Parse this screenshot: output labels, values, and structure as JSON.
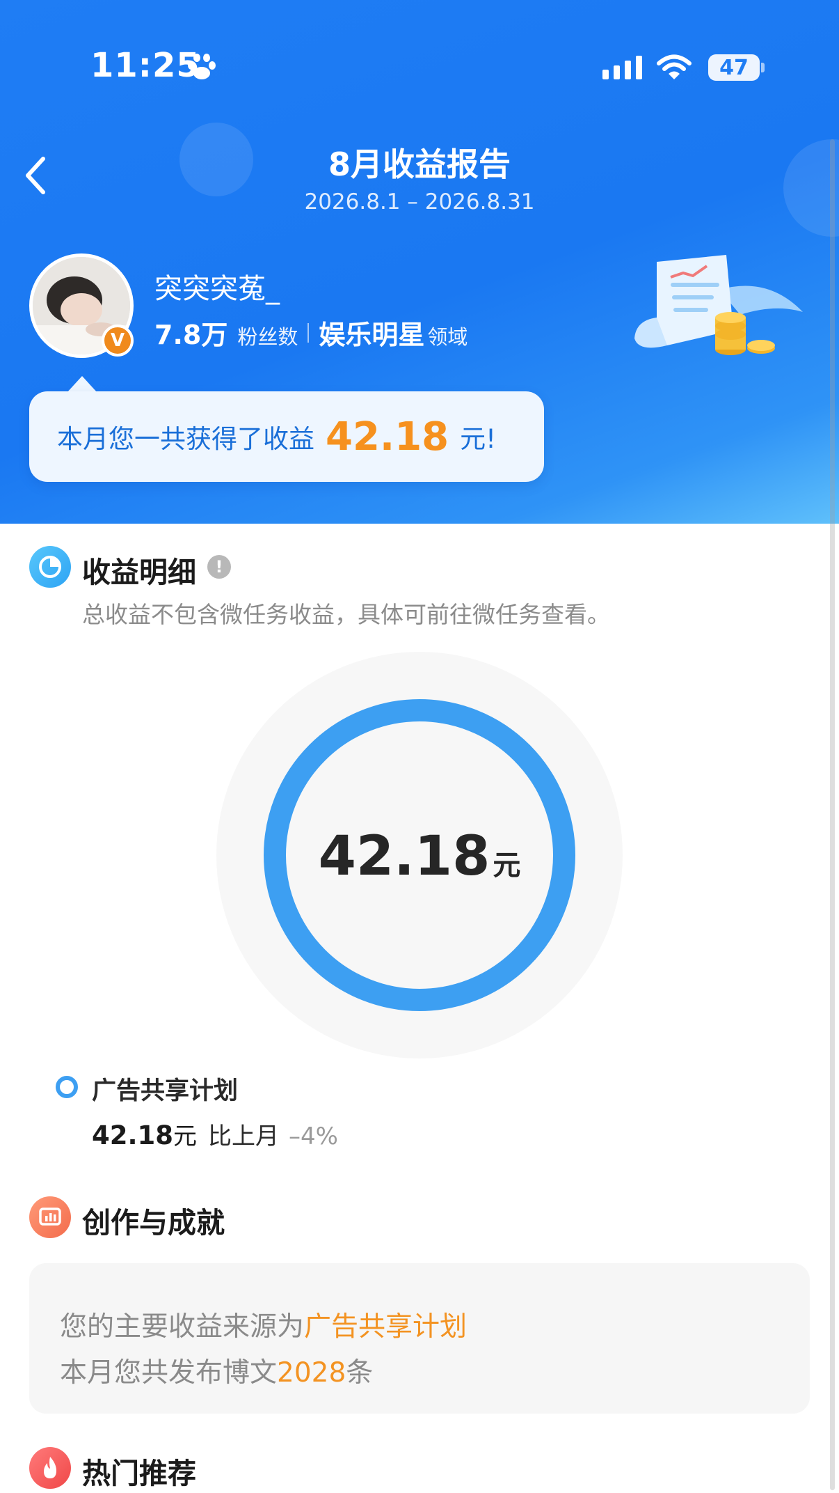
{
  "status_bar": {
    "time": "11:25",
    "battery": "47"
  },
  "header": {
    "title": "8月收益报告",
    "date_range": "2026.8.1 – 2026.8.31"
  },
  "profile": {
    "username": "突突突菟_",
    "fans_count": "7.8万",
    "fans_label": "粉丝数",
    "domain": "娱乐明星",
    "domain_suffix": "领域",
    "badge": "V"
  },
  "summary": {
    "prefix": "本月您一共获得了收益",
    "amount": "42.18",
    "suffix": "元!"
  },
  "earnings_detail": {
    "title": "收益明细",
    "info_icon": "!",
    "description": "总收益不包含微任务收益，具体可前往微任务查看。",
    "total_value": "42.18",
    "total_unit": "元",
    "legend": [
      {
        "name": "广告共享计划",
        "value": "42.18",
        "unit": "元",
        "compare_label": "比上月",
        "change": "–4%",
        "color": "#3d9ff2"
      }
    ]
  },
  "chart_data": {
    "type": "pie",
    "categories": [
      "广告共享计划"
    ],
    "values": [
      42.18
    ]
  },
  "creation": {
    "title": "创作与成就",
    "line1_prefix": "您的主要收益来源为",
    "line1_highlight": "广告共享计划",
    "line2_prefix": "本月您共发布博文",
    "line2_highlight": "2028",
    "line2_suffix": "条"
  },
  "hot": {
    "title": "热门推荐"
  },
  "colors": {
    "header_blue": "#1a78f2",
    "accent_orange": "#f6911e",
    "donut_blue": "#3d9ff2"
  },
  "icons": {
    "paw": "paw-icon",
    "signal": "signal-icon",
    "wifi": "wifi-icon",
    "back": "chevron-left-icon",
    "pie": "pie-chart-icon",
    "info": "info-icon",
    "chart": "bar-chart-icon",
    "fire": "fire-icon"
  }
}
